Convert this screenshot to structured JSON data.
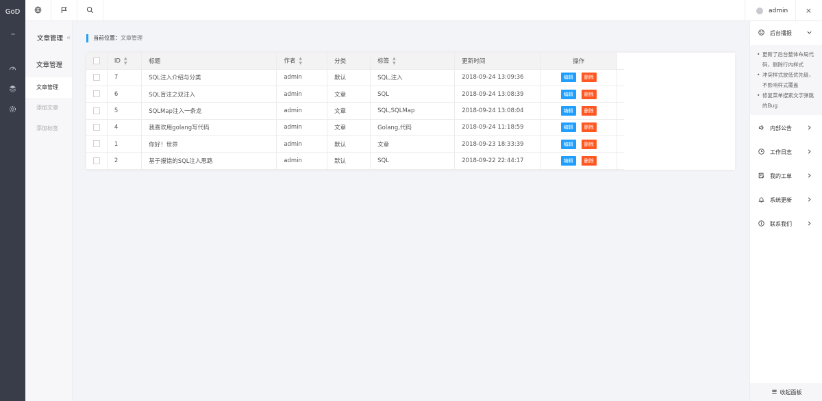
{
  "app": {
    "logo": "GoD",
    "more": "···"
  },
  "topbar": {
    "icons": [
      "globe-icon",
      "flag-icon",
      "search-icon"
    ],
    "user": "admin",
    "close": "×"
  },
  "submenu": {
    "title": "文章管理",
    "fold": "«",
    "group": "文章管理",
    "items": [
      {
        "label": "文章管理"
      },
      {
        "label": "添加文章"
      },
      {
        "label": "添加标签"
      }
    ]
  },
  "breadcrumb": {
    "label": "当前位置：",
    "current": "文章管理"
  },
  "table": {
    "headers": [
      "ID",
      "标题",
      "作者",
      "分类",
      "标签",
      "更新时间",
      "操作"
    ],
    "edit_label": "编辑",
    "delete_label": "删除",
    "rows": [
      {
        "id": "7",
        "title": "SQL注入介绍与分类",
        "author": "admin",
        "category": "默认",
        "tags": "SQL,注入",
        "updated": "2018-09-24 13:09:36"
      },
      {
        "id": "6",
        "title": "SQL盲注之双注入",
        "author": "admin",
        "category": "文章",
        "tags": "SQL",
        "updated": "2018-09-24 13:08:39"
      },
      {
        "id": "5",
        "title": "SQLMap注入一条龙",
        "author": "admin",
        "category": "文章",
        "tags": "SQL,SQLMap",
        "updated": "2018-09-24 13:08:04"
      },
      {
        "id": "4",
        "title": "我喜欢用golang写代码",
        "author": "admin",
        "category": "文章",
        "tags": "Golang,代码",
        "updated": "2018-09-24 11:18:59"
      },
      {
        "id": "1",
        "title": "你好！世界",
        "author": "admin",
        "category": "默认",
        "tags": "文章",
        "updated": "2018-09-23 18:33:39"
      },
      {
        "id": "2",
        "title": "基于报错的SQL注入思路",
        "author": "admin",
        "category": "默认",
        "tags": "SQL",
        "updated": "2018-09-22 22:44:17"
      }
    ]
  },
  "rpanel": {
    "report_title": "后台播报",
    "notes": [
      "更新了后台整体布局代码，剔除行内样式",
      "冲突样式放低优先级，不影响样式覆盖",
      "修复菜单搜索文字弹跳的Bug"
    ],
    "sections": [
      {
        "label": "内部公告",
        "icon": "speaker-icon"
      },
      {
        "label": "工作日志",
        "icon": "clock-icon"
      },
      {
        "label": "我的工单",
        "icon": "ticket-icon"
      },
      {
        "label": "系统更新",
        "icon": "bell-icon"
      },
      {
        "label": "联系我们",
        "icon": "info-icon"
      }
    ],
    "footer": "收起面板"
  },
  "colors": {
    "accent": "#1e9fff",
    "danger": "#ff5722",
    "rail": "#393d49"
  }
}
